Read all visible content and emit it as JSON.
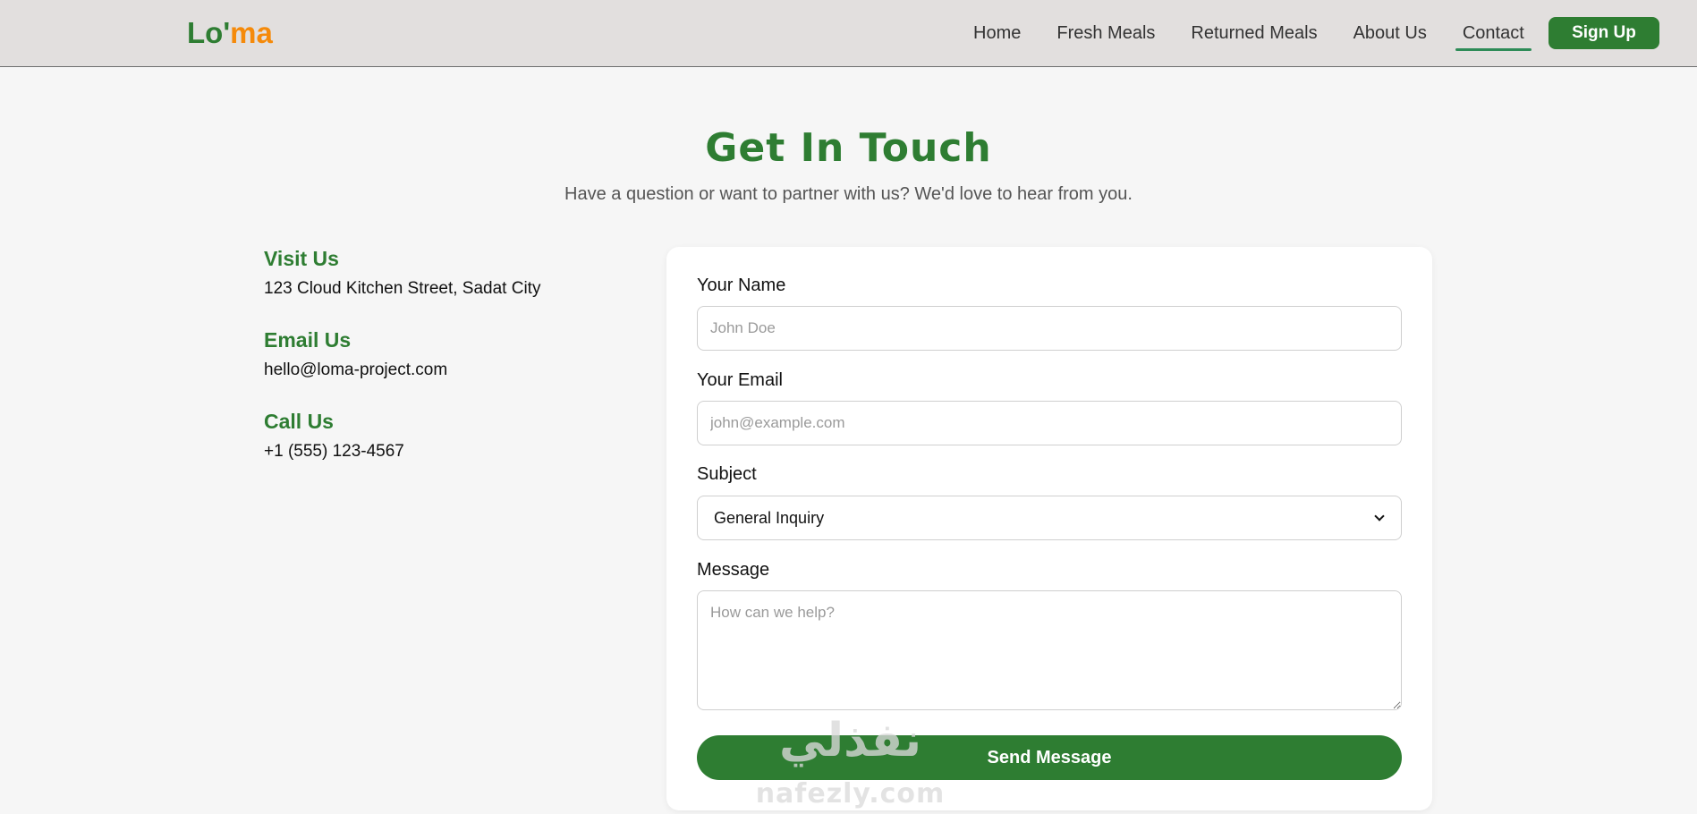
{
  "header": {
    "logo_part1": "Lo'",
    "logo_part2": "ma",
    "nav": [
      {
        "label": "Home"
      },
      {
        "label": "Fresh Meals"
      },
      {
        "label": "Returned Meals"
      },
      {
        "label": "About Us"
      },
      {
        "label": "Contact",
        "active": true
      }
    ],
    "signup_label": "Sign Up"
  },
  "hero": {
    "title": "Get In Touch",
    "subtitle": "Have a question or want to partner with us? We'd love to hear from you."
  },
  "contact_info": [
    {
      "heading": "Visit Us",
      "text": "123 Cloud Kitchen Street, Sadat City"
    },
    {
      "heading": "Email Us",
      "text": "hello@loma-project.com"
    },
    {
      "heading": "Call Us",
      "text": "+1 (555) 123-4567"
    }
  ],
  "form": {
    "name_label": "Your Name",
    "name_placeholder": "John Doe",
    "email_label": "Your Email",
    "email_placeholder": "john@example.com",
    "subject_label": "Subject",
    "subject_value": "General Inquiry",
    "message_label": "Message",
    "message_placeholder": "How can we help?",
    "send_label": "Send Message"
  },
  "watermark": {
    "arabic": "نفذلي",
    "latin": "nafezly.com"
  },
  "colors": {
    "brand_green": "#2e7d32",
    "brand_orange": "#f58a0a",
    "header_bg": "#e2dfde",
    "page_bg": "#f6f6f6"
  }
}
